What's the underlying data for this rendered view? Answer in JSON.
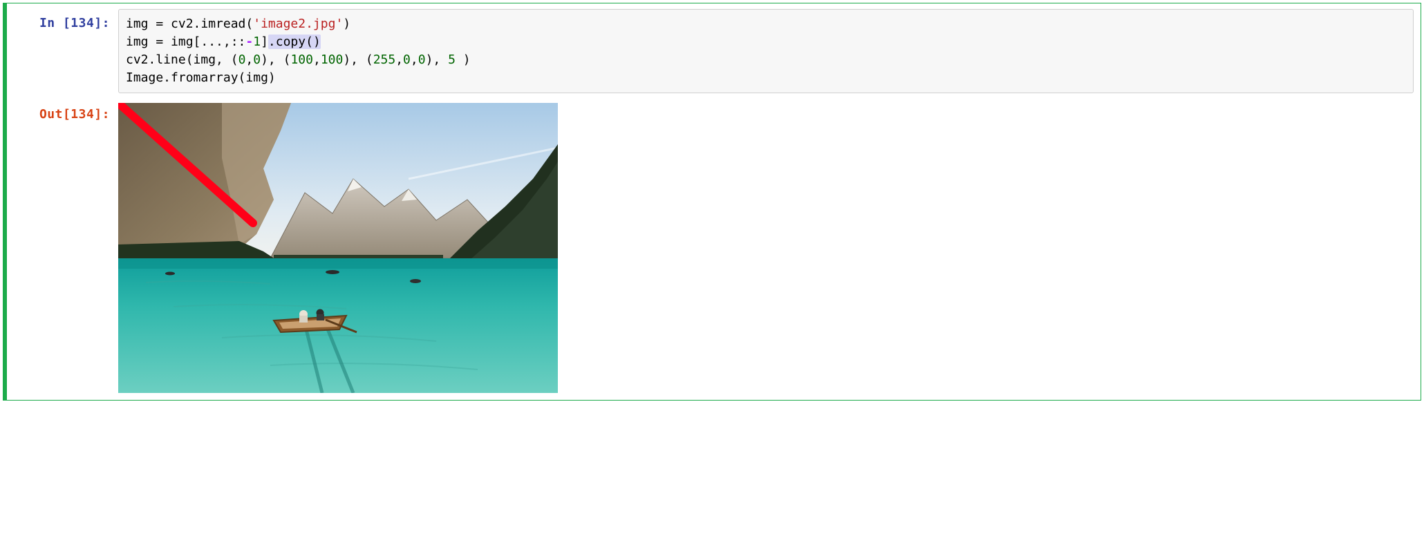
{
  "cell": {
    "exec_count": 134,
    "in_prefix": "In [",
    "in_suffix": "]:",
    "out_prefix": "Out[",
    "out_suffix": "]:",
    "code": {
      "l1": {
        "a": "img = cv2.imread(",
        "str": "'image2.jpg'",
        "b": ")"
      },
      "l2": {
        "a": "img = img[...,::",
        "neg": "-",
        "one": "1",
        "b": "]",
        "sel": ".copy()"
      },
      "l3": {
        "a": "cv2.line(img, (",
        "n0a": "0",
        "c1": ",",
        "n0b": "0",
        "b": "), (",
        "n100a": "100",
        "c2": ",",
        "n100b": "100",
        "c": "), (",
        "n255": "255",
        "c3": ",",
        "n0c": "0",
        "c4": ",",
        "n0d": "0",
        "d": "), ",
        "n5": "5",
        "e": " )"
      },
      "l4": {
        "a": "Image.fromarray(img)"
      }
    },
    "output_annotation": {
      "line_color": "#ff0018",
      "line_from": [
        0,
        0
      ],
      "line_to": [
        100,
        100
      ],
      "line_thickness": 5,
      "image_desc": "mountain-lake-with-boat"
    }
  }
}
